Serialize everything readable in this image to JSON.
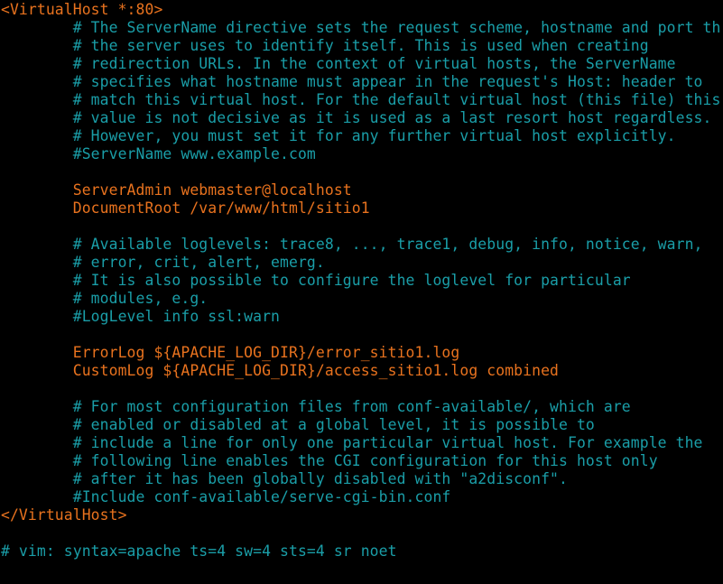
{
  "colors": {
    "background": "#000000",
    "comment": "#1a9ea8",
    "directive": "#e8721e",
    "tag": "#e8721e"
  },
  "editor": {
    "lines": [
      {
        "text": "<VirtualHost *:80>",
        "kind": "tag"
      },
      {
        "text": "        # The ServerName directive sets the request scheme, hostname and port th",
        "kind": "comment"
      },
      {
        "text": "        # the server uses to identify itself. This is used when creating",
        "kind": "comment"
      },
      {
        "text": "        # redirection URLs. In the context of virtual hosts, the ServerName",
        "kind": "comment"
      },
      {
        "text": "        # specifies what hostname must appear in the request's Host: header to",
        "kind": "comment"
      },
      {
        "text": "        # match this virtual host. For the default virtual host (this file) this",
        "kind": "comment"
      },
      {
        "text": "        # value is not decisive as it is used as a last resort host regardless.",
        "kind": "comment"
      },
      {
        "text": "        # However, you must set it for any further virtual host explicitly.",
        "kind": "comment"
      },
      {
        "text": "        #ServerName www.example.com",
        "kind": "comment"
      },
      {
        "text": "",
        "kind": "blank"
      },
      {
        "text": "        ServerAdmin webmaster@localhost",
        "kind": "directive"
      },
      {
        "text": "        DocumentRoot /var/www/html/sitio1",
        "kind": "directive"
      },
      {
        "text": "",
        "kind": "blank"
      },
      {
        "text": "        # Available loglevels: trace8, ..., trace1, debug, info, notice, warn,",
        "kind": "comment"
      },
      {
        "text": "        # error, crit, alert, emerg.",
        "kind": "comment"
      },
      {
        "text": "        # It is also possible to configure the loglevel for particular",
        "kind": "comment"
      },
      {
        "text": "        # modules, e.g.",
        "kind": "comment"
      },
      {
        "text": "        #LogLevel info ssl:warn",
        "kind": "comment"
      },
      {
        "text": "",
        "kind": "blank"
      },
      {
        "text": "        ErrorLog ${APACHE_LOG_DIR}/error_sitio1.log",
        "kind": "directive"
      },
      {
        "text": "        CustomLog ${APACHE_LOG_DIR}/access_sitio1.log combined",
        "kind": "directive"
      },
      {
        "text": "",
        "kind": "blank"
      },
      {
        "text": "        # For most configuration files from conf-available/, which are",
        "kind": "comment"
      },
      {
        "text": "        # enabled or disabled at a global level, it is possible to",
        "kind": "comment"
      },
      {
        "text": "        # include a line for only one particular virtual host. For example the",
        "kind": "comment"
      },
      {
        "text": "        # following line enables the CGI configuration for this host only",
        "kind": "comment"
      },
      {
        "text": "        # after it has been globally disabled with \"a2disconf\".",
        "kind": "comment"
      },
      {
        "text": "        #Include conf-available/serve-cgi-bin.conf",
        "kind": "comment"
      },
      {
        "text": "</VirtualHost>",
        "kind": "tag"
      },
      {
        "text": "",
        "kind": "blank"
      },
      {
        "text": "# vim: syntax=apache ts=4 sw=4 sts=4 sr noet",
        "kind": "comment"
      }
    ]
  }
}
